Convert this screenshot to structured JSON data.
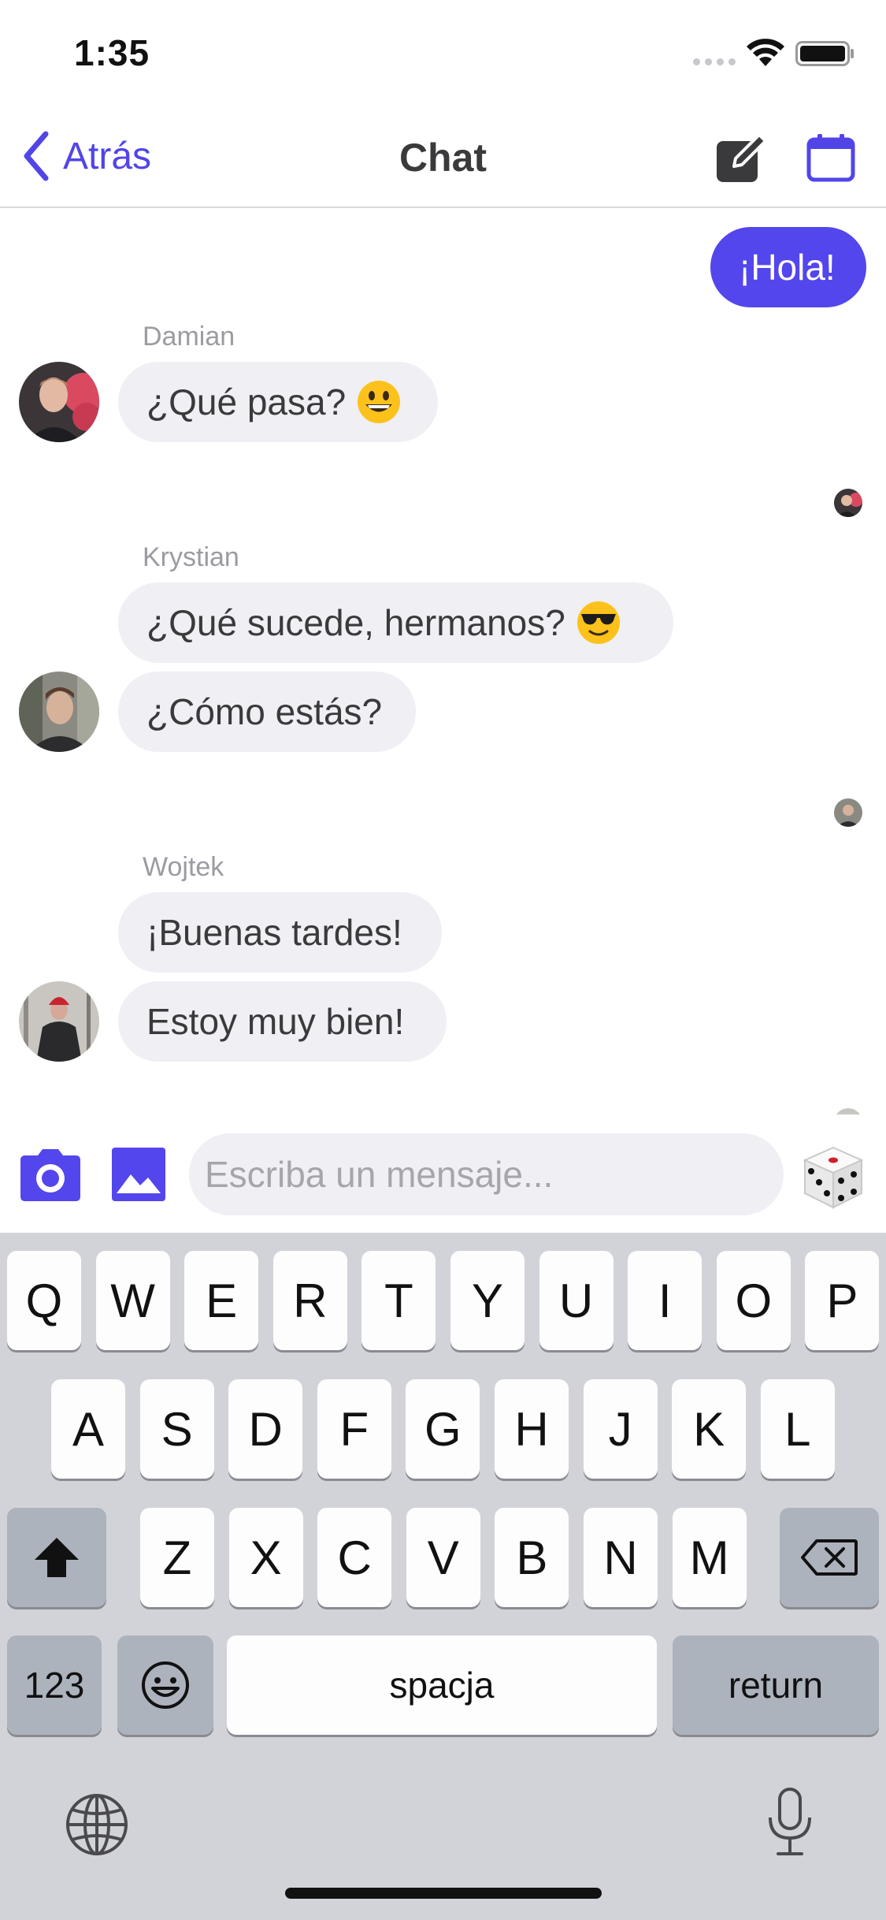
{
  "status_bar": {
    "time": "1:35",
    "icons": [
      "signal-icon",
      "wifi-icon",
      "battery-icon"
    ]
  },
  "nav": {
    "back_label": "Atrás",
    "title": "Chat",
    "icons": {
      "back": "chevron-left-icon",
      "compose": "compose-icon",
      "calendar": "calendar-icon"
    }
  },
  "colors": {
    "accent": "#5346ec",
    "incoming_bubble": "#efeff4",
    "keyboard_bg": "#d1d3d9"
  },
  "messages": {
    "outgoing": {
      "text": "¡Hola!"
    },
    "groups": [
      {
        "sender": "Damian",
        "bubbles": [
          {
            "text": "¿Qué pasa?",
            "emoji": "grinning-face-emoji"
          }
        ]
      },
      {
        "sender": "Krystian",
        "bubbles": [
          {
            "text": "¿Qué sucede, hermanos?",
            "emoji": "sunglasses-face-emoji"
          },
          {
            "text": "¿Cómo estás?"
          }
        ]
      },
      {
        "sender": "Wojtek",
        "bubbles": [
          {
            "text": "¡Buenas tardes!"
          },
          {
            "text": "Estoy muy bien!"
          }
        ]
      }
    ]
  },
  "composer": {
    "placeholder": "Escriba un mensaje...",
    "icons": {
      "camera": "camera-icon",
      "gallery": "image-icon",
      "dice": "dice-icon"
    }
  },
  "keyboard": {
    "row1": [
      "Q",
      "W",
      "E",
      "R",
      "T",
      "Y",
      "U",
      "I",
      "O",
      "P"
    ],
    "row2": [
      "A",
      "S",
      "D",
      "F",
      "G",
      "H",
      "J",
      "K",
      "L"
    ],
    "row3": [
      "Z",
      "X",
      "C",
      "V",
      "B",
      "N",
      "M"
    ],
    "numbers_label": "123",
    "space_label": "spacja",
    "return_label": "return",
    "icons": {
      "shift": "shift-icon",
      "delete": "backspace-icon",
      "emoji": "emoji-icon",
      "globe": "globe-icon",
      "mic": "microphone-icon"
    }
  }
}
